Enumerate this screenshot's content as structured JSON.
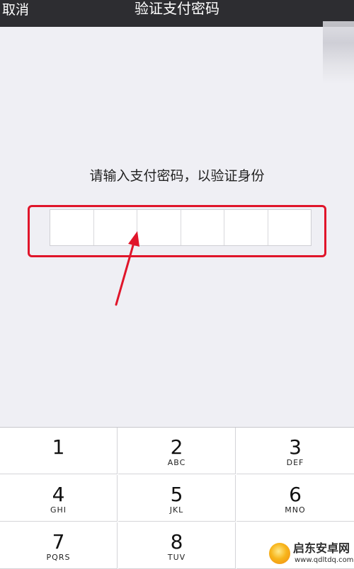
{
  "navbar": {
    "cancel_label": "取消",
    "title": "验证支付密码"
  },
  "prompt": "请输入支付密码，以验证身份",
  "pin": {
    "length": 6,
    "filled": 0
  },
  "annotation": {
    "highlight_color": "#e0152a"
  },
  "keypad": {
    "keys": [
      {
        "digit": "1",
        "letters": ""
      },
      {
        "digit": "2",
        "letters": "ABC"
      },
      {
        "digit": "3",
        "letters": "DEF"
      },
      {
        "digit": "4",
        "letters": "GHI"
      },
      {
        "digit": "5",
        "letters": "JKL"
      },
      {
        "digit": "6",
        "letters": "MNO"
      },
      {
        "digit": "7",
        "letters": "PQRS"
      },
      {
        "digit": "8",
        "letters": "TUV"
      }
    ]
  },
  "watermark": {
    "logo_icon": "rocket-logo-icon",
    "name": "启东安卓网",
    "url": "www.qdltdq.com"
  }
}
